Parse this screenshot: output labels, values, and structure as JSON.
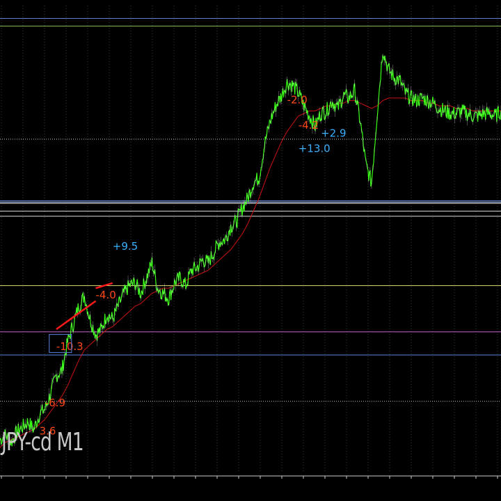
{
  "chart_data": {
    "type": "line",
    "symbol_label": "JPY-cd M1",
    "colors": {
      "background": "#000000",
      "price_series": "#39ff14",
      "moving_average": "#cc1111",
      "grid": "#8a8a8a",
      "profit_label": "#3ab0ff",
      "loss_label": "#ff4a1a",
      "trade_line": "#ff1a1a"
    },
    "series": [
      {
        "kind": "price",
        "values": [
          0.03,
          0.05,
          0.02,
          0.06,
          0.08,
          0.1,
          0.07,
          0.13,
          0.15,
          0.21,
          0.28,
          0.3,
          0.41,
          0.48,
          0.55,
          0.59,
          0.5,
          0.44,
          0.46,
          0.52,
          0.5,
          0.55,
          0.6,
          0.63,
          0.64,
          0.6,
          0.66,
          0.72,
          0.62,
          0.6,
          0.58,
          0.64,
          0.66,
          0.63,
          0.69,
          0.7,
          0.73,
          0.72,
          0.76,
          0.8,
          0.81,
          0.86,
          0.88,
          0.93,
          0.97,
          1.03,
          1.05,
          1.18,
          1.27,
          1.33,
          1.37,
          1.42,
          1.41,
          1.38,
          1.33,
          1.29,
          1.25,
          1.3,
          1.31,
          1.35,
          1.32,
          1.37,
          1.36,
          1.39,
          1.27,
          1.1,
          1.03,
          1.3,
          1.55,
          1.47,
          1.44,
          1.43,
          1.38,
          1.36,
          1.35,
          1.36,
          1.35,
          1.34,
          1.32,
          1.31,
          1.3,
          1.3,
          1.31,
          1.3,
          1.29,
          1.29,
          1.3,
          1.3,
          1.29,
          1.31
        ]
      },
      {
        "kind": "moving_average",
        "values": [
          0.0,
          0.02,
          0.03,
          0.04,
          0.05,
          0.06,
          0.07,
          0.09,
          0.11,
          0.14,
          0.17,
          0.2,
          0.24,
          0.29,
          0.34,
          0.38,
          0.4,
          0.42,
          0.44,
          0.46,
          0.47,
          0.49,
          0.51,
          0.53,
          0.55,
          0.56,
          0.58,
          0.6,
          0.61,
          0.62,
          0.62,
          0.63,
          0.64,
          0.65,
          0.66,
          0.67,
          0.68,
          0.69,
          0.71,
          0.73,
          0.75,
          0.77,
          0.8,
          0.83,
          0.87,
          0.92,
          0.97,
          1.03,
          1.09,
          1.14,
          1.19,
          1.23,
          1.26,
          1.29,
          1.3,
          1.31,
          1.31,
          1.32,
          1.33,
          1.33,
          1.34,
          1.34,
          1.35,
          1.35,
          1.34,
          1.33,
          1.32,
          1.33,
          1.35,
          1.36,
          1.36,
          1.36,
          1.36,
          1.35,
          1.35,
          1.35,
          1.34,
          1.34,
          1.33,
          1.33,
          1.33,
          1.32,
          1.32,
          1.32,
          1.31,
          1.31,
          1.31,
          1.31,
          1.31,
          1.31
        ]
      }
    ],
    "horizontal_levels": [
      {
        "value": 1.67,
        "style": "solid",
        "color": "#5e7fcf"
      },
      {
        "value": 1.64,
        "style": "solid",
        "color": "#86b45a"
      },
      {
        "value": 1.2,
        "style": "dotted",
        "color": "#c0c0c0"
      },
      {
        "value": 0.96,
        "style": "solid",
        "color": "#6f8fe0"
      },
      {
        "value": 0.955,
        "style": "solid",
        "color": "#a8c8ff"
      },
      {
        "value": 0.95,
        "style": "solid",
        "color": "#e0e0e0"
      },
      {
        "value": 0.92,
        "style": "solid",
        "color": "#dcdcdc"
      },
      {
        "value": 0.9,
        "style": "solid",
        "color": "#dcdcdc"
      },
      {
        "value": 0.63,
        "style": "solid",
        "color": "#d6d26a"
      },
      {
        "value": 0.45,
        "style": "solid",
        "color": "#c266cc"
      },
      {
        "value": 0.36,
        "style": "solid",
        "color": "#5b84e0"
      },
      {
        "value": 0.18,
        "style": "dotted",
        "color": "#c0c0c0"
      }
    ],
    "y_range": [
      -0.1,
      1.72
    ],
    "x_count": 90,
    "vertical_grid": true,
    "trade_annotations": [
      {
        "text": "3.6",
        "x": 7,
        "y": 0.05,
        "sign": "loss"
      },
      {
        "text": "-6.9",
        "x": 8,
        "y": 0.16,
        "sign": "loss"
      },
      {
        "text": "-10.3",
        "x": 10,
        "y": 0.38,
        "sign": "loss"
      },
      {
        "text": "-4.0",
        "x": 17,
        "y": 0.58,
        "sign": "loss"
      },
      {
        "text": "+9.5",
        "x": 20,
        "y": 0.77,
        "sign": "profit"
      },
      {
        "text": "-2.0",
        "x": 51,
        "y": 1.34,
        "sign": "loss"
      },
      {
        "text": "-4.2",
        "x": 53,
        "y": 1.24,
        "sign": "loss"
      },
      {
        "text": "+13.0",
        "x": 53,
        "y": 1.15,
        "sign": "profit"
      },
      {
        "text": "+2.9",
        "x": 57,
        "y": 1.21,
        "sign": "profit"
      }
    ],
    "trade_lines": [
      {
        "x1": 10,
        "y1": 0.46,
        "x2": 17,
        "y2": 0.57
      },
      {
        "x1": 17,
        "y1": 0.62,
        "x2": 20,
        "y2": 0.64
      }
    ]
  }
}
